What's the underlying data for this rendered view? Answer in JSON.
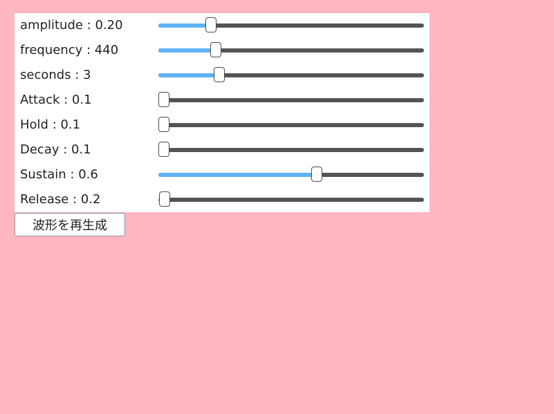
{
  "params": [
    {
      "name": "amplitude",
      "display": "amplitude : 0.20",
      "value": 0.2,
      "min": 0,
      "max": 1
    },
    {
      "name": "frequency",
      "display": "frequency : 440",
      "value": 440,
      "min": 0,
      "max": 2000
    },
    {
      "name": "seconds",
      "display": "seconds : 3",
      "value": 3,
      "min": 0,
      "max": 13
    },
    {
      "name": "attack",
      "display": "Attack : 0.1",
      "value": 0.1,
      "min": 0.1,
      "max": 1
    },
    {
      "name": "hold",
      "display": "Hold : 0.1",
      "value": 0.1,
      "min": 0.1,
      "max": 1
    },
    {
      "name": "decay",
      "display": "Decay : 0.1",
      "value": 0.1,
      "min": 0.1,
      "max": 1
    },
    {
      "name": "sustain",
      "display": "Sustain : 0.6",
      "value": 0.6,
      "min": 0,
      "max": 1
    },
    {
      "name": "release",
      "display": "Release : 0.2",
      "value": 0.2,
      "min": 0.1,
      "max": 4
    }
  ],
  "regenerate_button": {
    "label": "波形を再生成"
  },
  "colors": {
    "background": "#ffb6c1",
    "panel": "#ffffff",
    "track": "#545454",
    "fill": "#5fb3f6",
    "thumb": "#ffffff"
  }
}
